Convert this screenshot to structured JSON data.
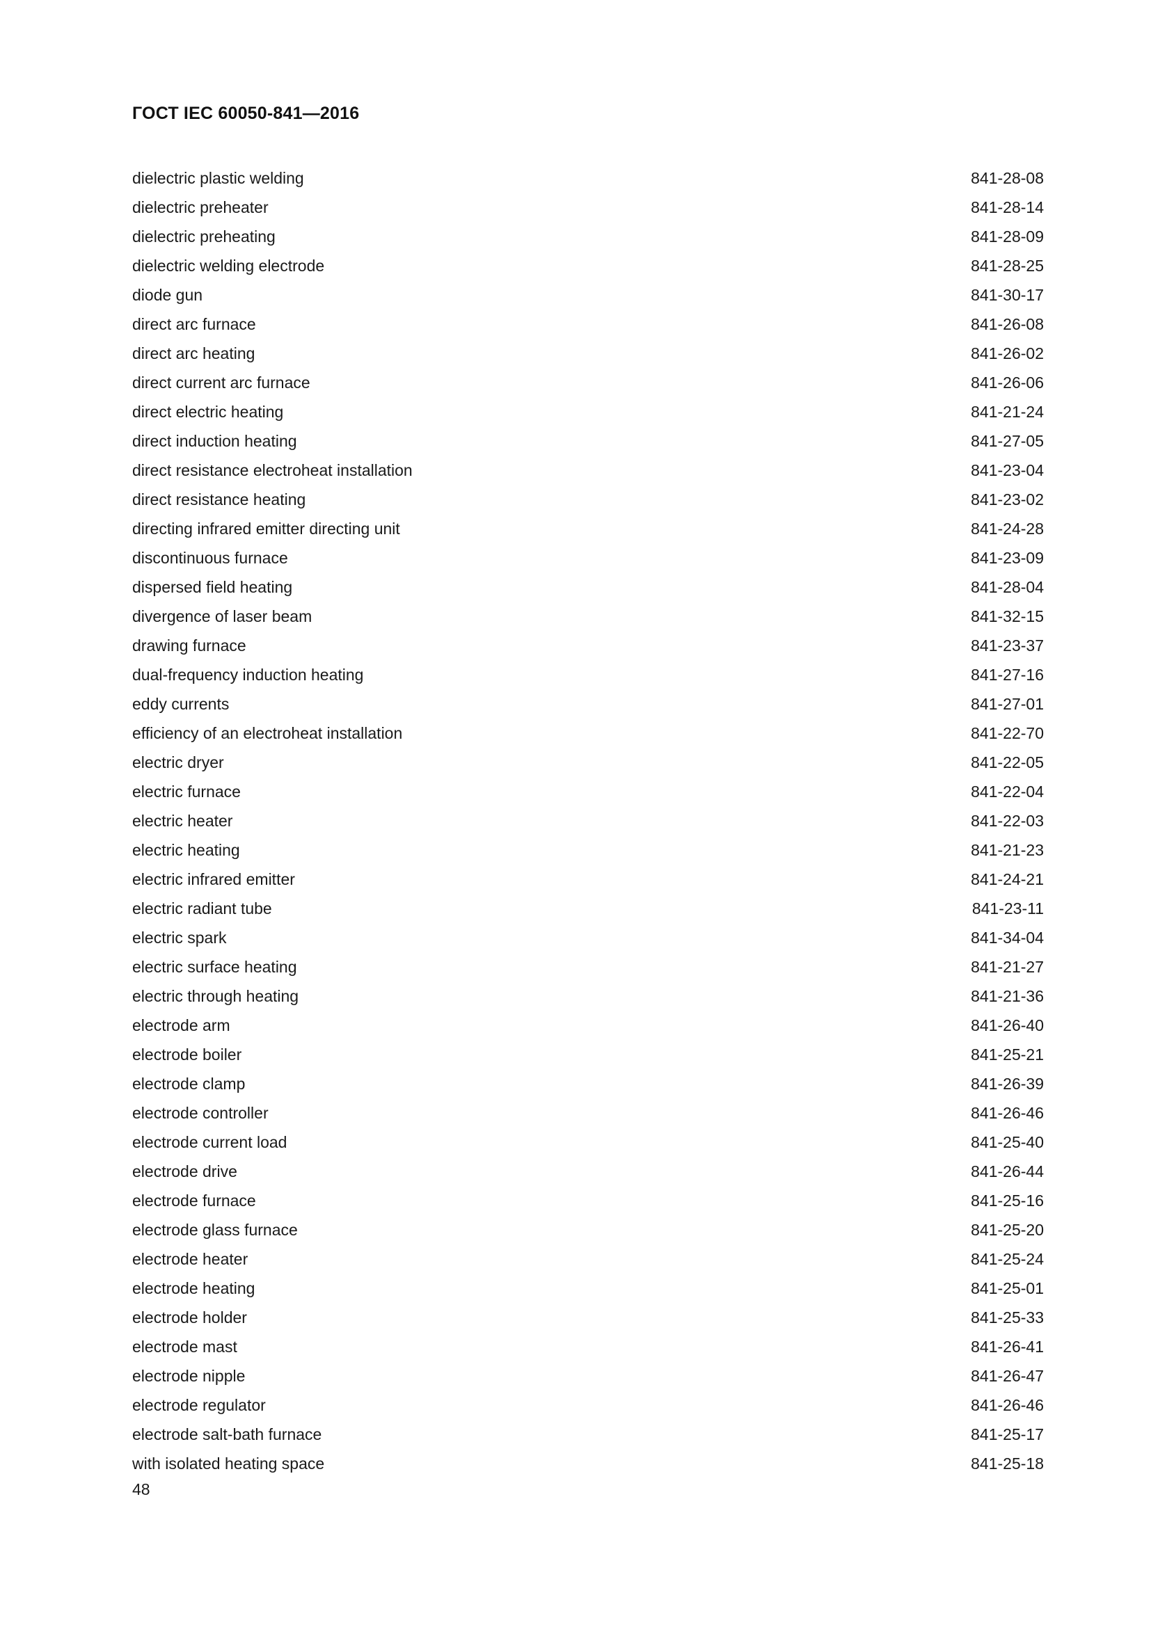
{
  "document": {
    "header": "ГОСТ IEC 60050-841—2016",
    "page_number": "48"
  },
  "index": {
    "entries": [
      {
        "term": "dielectric plastic welding",
        "code": "841-28-08"
      },
      {
        "term": "dielectric preheater",
        "code": "841-28-14"
      },
      {
        "term": "dielectric preheating",
        "code": "841-28-09"
      },
      {
        "term": "dielectric welding electrode",
        "code": "841-28-25"
      },
      {
        "term": "diode gun",
        "code": "841-30-17"
      },
      {
        "term": "direct arc furnace",
        "code": "841-26-08"
      },
      {
        "term": "direct arc heating",
        "code": "841-26-02"
      },
      {
        "term": "direct current arc furnace",
        "code": "841-26-06"
      },
      {
        "term": "direct electric heating",
        "code": "841-21-24"
      },
      {
        "term": "direct induction heating",
        "code": "841-27-05"
      },
      {
        "term": "direct resistance electroheat installation",
        "code": "841-23-04"
      },
      {
        "term": "direct resistance heating",
        "code": "841-23-02"
      },
      {
        "term": "directing infrared emitter directing unit",
        "code": "841-24-28"
      },
      {
        "term": "discontinuous furnace",
        "code": "841-23-09"
      },
      {
        "term": "dispersed field heating",
        "code": "841-28-04"
      },
      {
        "term": "divergence of laser beam",
        "code": "841-32-15"
      },
      {
        "term": "drawing furnace",
        "code": "841-23-37"
      },
      {
        "term": "dual-frequency induction heating",
        "code": "841-27-16"
      },
      {
        "term": "eddy currents",
        "code": "841-27-01"
      },
      {
        "term": "efficiency of an electroheat installation",
        "code": "841-22-70"
      },
      {
        "term": "electric dryer",
        "code": "841-22-05"
      },
      {
        "term": "electric furnace",
        "code": "841-22-04"
      },
      {
        "term": "electric heater",
        "code": "841-22-03"
      },
      {
        "term": "electric heating",
        "code": "841-21-23"
      },
      {
        "term": "electric infrared emitter",
        "code": "841-24-21"
      },
      {
        "term": "electric radiant tube",
        "code": "841-23-11"
      },
      {
        "term": "electric spark",
        "code": "841-34-04"
      },
      {
        "term": "electric surface heating",
        "code": "841-21-27"
      },
      {
        "term": "electric through heating",
        "code": "841-21-36"
      },
      {
        "term": "electrode arm",
        "code": "841-26-40"
      },
      {
        "term": "electrode boiler",
        "code": "841-25-21"
      },
      {
        "term": "electrode clamp",
        "code": "841-26-39"
      },
      {
        "term": "electrode controller",
        "code": "841-26-46"
      },
      {
        "term": "electrode current load",
        "code": "841-25-40"
      },
      {
        "term": "electrode drive",
        "code": "841-26-44"
      },
      {
        "term": "electrode furnace",
        "code": "841-25-16"
      },
      {
        "term": "electrode glass furnace",
        "code": "841-25-20"
      },
      {
        "term": "electrode heater",
        "code": "841-25-24"
      },
      {
        "term": "electrode heating",
        "code": "841-25-01"
      },
      {
        "term": "electrode holder",
        "code": "841-25-33"
      },
      {
        "term": "electrode mast",
        "code": "841-26-41"
      },
      {
        "term": "electrode nipple",
        "code": "841-26-47"
      },
      {
        "term": "electrode regulator",
        "code": "841-26-46"
      },
      {
        "term": "electrode salt-bath furnace",
        "code": "841-25-17"
      },
      {
        "term": "with isolated heating space",
        "code": "841-25-18"
      }
    ]
  }
}
